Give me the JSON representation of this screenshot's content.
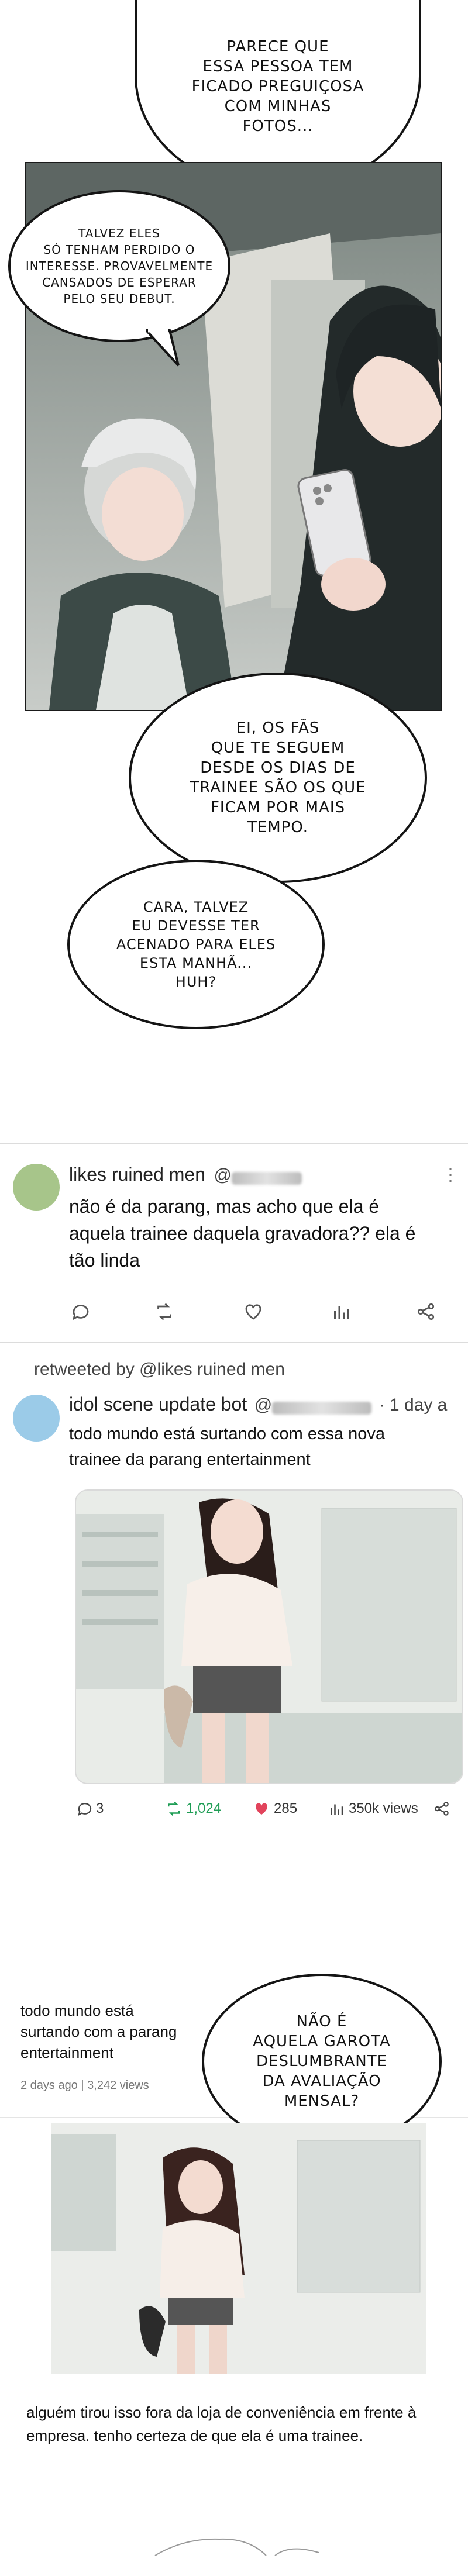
{
  "page1": {
    "bubble_top": "PARECE QUE\nESSA PESSOA TEM\nFICADO PREGUIÇOSA\nCOM MINHAS\nFOTOS...",
    "bubble_left": "TALVEZ ELES\nSÓ TENHAM PERDIDO O\nINTERESSE. PROVAVELMENTE\nCANSADOS DE ESPERAR\nPELO SEU DEBUT.",
    "bubble_mid": "EI, OS FÃS\nQUE TE SEGUEM\nDESDE OS DIAS DE\nTRAINEE SÃO OS QUE\nFICAM POR MAIS\nTEMPO.",
    "bubble_low": "CARA, TALVEZ\nEU DEVESSE TER\nACENADO PARA ELES\nESTA MANHÃ...\nHUH?"
  },
  "post1": {
    "avatar_color": "#a7c58a",
    "user": "likes ruined men",
    "handle_prefix": "@",
    "text": "não é da parang, mas acho que ela é aquela trainee daquela gravadora?? ela é tão linda",
    "more_icon": "more-vertical-icon"
  },
  "retweet": {
    "label": "retweeted by @likes ruined men"
  },
  "post2": {
    "avatar_color": "#9bcbe8",
    "user": "idol scene update bot",
    "handle_prefix": "@",
    "time": "· 1 day a",
    "text": "todo mundo está surtando com essa nova trainee da parang entertainment",
    "replies": "3",
    "retweets": "1,024",
    "likes": "285",
    "views": "350k views",
    "retweet_color": "#1f9d55",
    "like_color": "#e2445c"
  },
  "post3": {
    "title": "todo mundo está surtando com a parang entertainment",
    "meta": "2 days ago | 3,242 views",
    "bubble": "NÃO É\nAQUELA GAROTA\nDESLUMBRANTE\nDA AVALIAÇÃO\nMENSAL?",
    "caption": "alguém tirou isso fora da loja de conveniência em frente à empresa. tenho certeza de que ela é uma trainee."
  }
}
